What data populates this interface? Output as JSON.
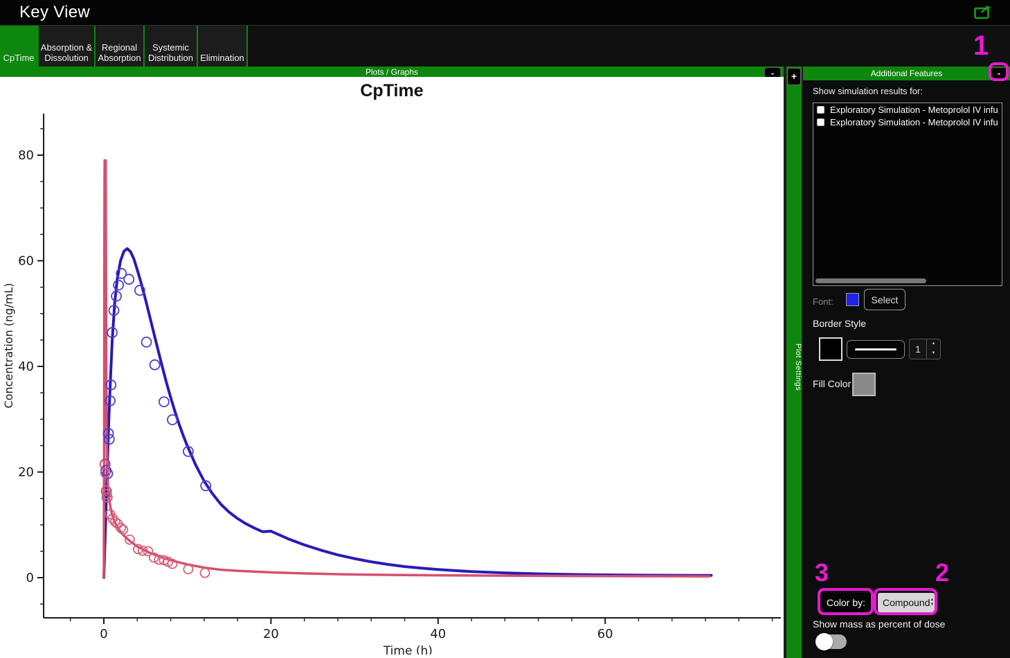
{
  "window": {
    "title": "Key View"
  },
  "tabs": [
    {
      "label": "CpTime",
      "active": true
    },
    {
      "label": "Absorption &\nDissolution",
      "active": false
    },
    {
      "label": "Regional\nAbsorption",
      "active": false
    },
    {
      "label": "Systemic\nDistribution",
      "active": false
    },
    {
      "label": "Elimination",
      "active": false
    }
  ],
  "plots_panel": {
    "header": "Plots / Graphs",
    "collapse_label": "-",
    "expand_label": "+",
    "strip_label": "Plot Settings"
  },
  "sidebar": {
    "header": "Additional Features",
    "collapse_label": "-",
    "results_label": "Show simulation results for:",
    "results": [
      {
        "label": "Exploratory Simulation - Metoprolol IV infu",
        "checked": false
      },
      {
        "label": "Exploratory Simulation - Metoprolol IV infu",
        "checked": false
      }
    ],
    "font_label": "Font:",
    "select_label": "Select",
    "border_style_label": "Border Style",
    "border_width_value": "1",
    "fill_color_label": "Fill Color",
    "color_by_label": "Color by:",
    "color_by_value": "Compound",
    "show_mass_label": "Show mass as percent of dose",
    "show_mass_on": false
  },
  "annotations": [
    {
      "number": "1"
    },
    {
      "number": "2"
    },
    {
      "number": "3"
    }
  ],
  "colors": {
    "accent_green": "#0d870d",
    "annotation_magenta": "#e61ad0",
    "font_swatch_blue": "#2222ee",
    "fill_swatch_gray": "#8a8a8a",
    "border_swatch_black": "#000000"
  },
  "chart_data": {
    "type": "line",
    "title": "CpTime",
    "xlabel": "Time (h)",
    "ylabel": "Concentration (ng/mL)",
    "xlim": [
      -7.2,
      81
    ],
    "ylim": [
      -7.7,
      87.5
    ],
    "x_major_ticks": [
      0,
      20,
      40,
      60
    ],
    "x_minor_step": 4,
    "y_major_ticks": [
      0,
      20,
      40,
      60,
      80
    ],
    "y_minor_step": 5,
    "grid": false,
    "legend": "none",
    "series": [
      {
        "name": "simulated-line-blue",
        "type": "line",
        "color": "#2a1ab9",
        "width": 4,
        "points": [
          [
            0,
            0
          ],
          [
            0.2,
            10
          ],
          [
            0.4,
            20
          ],
          [
            0.6,
            30
          ],
          [
            0.8,
            38
          ],
          [
            1.0,
            45
          ],
          [
            1.3,
            52
          ],
          [
            1.6,
            56.5
          ],
          [
            2.0,
            60
          ],
          [
            2.4,
            61.8
          ],
          [
            2.8,
            62.3
          ],
          [
            3.2,
            61.7
          ],
          [
            3.6,
            60.3
          ],
          [
            4.0,
            58.3
          ],
          [
            4.5,
            55.6
          ],
          [
            5,
            52.6
          ],
          [
            5.5,
            49.4
          ],
          [
            6,
            46.2
          ],
          [
            6.5,
            43
          ],
          [
            7,
            39.9
          ],
          [
            7.5,
            36.9
          ],
          [
            8,
            34.1
          ],
          [
            8.5,
            31.5
          ],
          [
            9,
            29.1
          ],
          [
            9.5,
            26.9
          ],
          [
            10,
            24.9
          ],
          [
            11,
            21.3
          ],
          [
            12,
            18.3
          ],
          [
            13,
            15.9
          ],
          [
            14,
            13.9
          ],
          [
            15,
            12.4
          ],
          [
            16,
            11.2
          ],
          [
            17,
            10.2
          ],
          [
            18,
            9.4
          ],
          [
            19,
            8.7
          ],
          [
            20,
            8.8
          ],
          [
            22,
            7.4
          ],
          [
            24,
            6.2
          ],
          [
            26,
            5.2
          ],
          [
            28,
            4.3
          ],
          [
            30,
            3.6
          ],
          [
            32,
            3.0
          ],
          [
            34,
            2.5
          ],
          [
            36,
            2.1
          ],
          [
            38,
            1.8
          ],
          [
            40,
            1.55
          ],
          [
            44,
            1.15
          ],
          [
            48,
            0.9
          ],
          [
            52,
            0.72
          ],
          [
            56,
            0.6
          ],
          [
            60,
            0.52
          ],
          [
            64,
            0.47
          ],
          [
            68,
            0.44
          ],
          [
            72.7,
            0.42
          ]
        ]
      },
      {
        "name": "simulated-line-red",
        "type": "line",
        "color": "#d5506e",
        "width": 3.5,
        "points": [
          [
            0,
            0
          ],
          [
            0.04,
            30
          ],
          [
            0.06,
            60
          ],
          [
            0.08,
            76
          ],
          [
            0.1,
            79
          ],
          [
            0.22,
            79
          ],
          [
            0.26,
            60
          ],
          [
            0.3,
            38
          ],
          [
            0.34,
            27
          ],
          [
            0.4,
            21.5
          ],
          [
            0.5,
            17.5
          ],
          [
            0.65,
            14.8
          ],
          [
            0.8,
            13.2
          ],
          [
            1,
            11.8
          ],
          [
            1.25,
            10.7
          ],
          [
            1.5,
            9.9
          ],
          [
            2,
            8.7
          ],
          [
            2.5,
            7.8
          ],
          [
            3,
            7.1
          ],
          [
            3.5,
            6.5
          ],
          [
            4,
            5.9
          ],
          [
            4.5,
            5.5
          ],
          [
            5,
            5.1
          ],
          [
            5.5,
            4.7
          ],
          [
            6,
            4.4
          ],
          [
            7,
            3.8
          ],
          [
            8,
            3.3
          ],
          [
            9,
            2.9
          ],
          [
            10,
            2.5
          ],
          [
            11,
            2.2
          ],
          [
            12,
            1.9
          ],
          [
            14,
            1.5
          ],
          [
            16,
            1.3
          ],
          [
            18,
            1.15
          ],
          [
            20,
            1.0
          ],
          [
            24,
            0.8
          ],
          [
            28,
            0.65
          ],
          [
            32,
            0.55
          ],
          [
            36,
            0.5
          ],
          [
            40,
            0.45
          ],
          [
            48,
            0.38
          ],
          [
            56,
            0.32
          ],
          [
            64,
            0.28
          ],
          [
            72.5,
            0.25
          ]
        ]
      },
      {
        "name": "observed-scatter-blue",
        "type": "scatter",
        "color": "#4a3fd0",
        "radius": 7,
        "points": [
          [
            0.15,
            21.5
          ],
          [
            0.25,
            20.3
          ],
          [
            0.3,
            16.4
          ],
          [
            0.4,
            15.2
          ],
          [
            0.45,
            19.7
          ],
          [
            0.55,
            27.3
          ],
          [
            0.65,
            26.2
          ],
          [
            0.75,
            33.5
          ],
          [
            0.85,
            36.5
          ],
          [
            1.0,
            46.4
          ],
          [
            1.2,
            50.6
          ],
          [
            1.5,
            53.3
          ],
          [
            1.75,
            55.4
          ],
          [
            2.1,
            57.6
          ],
          [
            3.0,
            56.5
          ],
          [
            4.3,
            54.4
          ],
          [
            5.1,
            44.6
          ],
          [
            6.1,
            40.3
          ],
          [
            7.2,
            33.3
          ],
          [
            8.2,
            29.9
          ],
          [
            10.1,
            23.9
          ],
          [
            12.2,
            17.4
          ]
        ]
      },
      {
        "name": "observed-scatter-red",
        "type": "scatter",
        "color": "#d5607a",
        "radius": 6.5,
        "points": [
          [
            0.1,
            21.4
          ],
          [
            0.18,
            19.8
          ],
          [
            0.28,
            16.5
          ],
          [
            0.35,
            15.8
          ],
          [
            0.42,
            15.2
          ],
          [
            0.75,
            12.0
          ],
          [
            1.05,
            11.2
          ],
          [
            1.35,
            10.6
          ],
          [
            1.65,
            10.2
          ],
          [
            2.05,
            9.4
          ],
          [
            2.3,
            9.1
          ],
          [
            3.1,
            7.2
          ],
          [
            4.1,
            5.4
          ],
          [
            4.65,
            5.1
          ],
          [
            5.3,
            5.0
          ],
          [
            6.0,
            3.8
          ],
          [
            6.6,
            3.4
          ],
          [
            7.2,
            3.3
          ],
          [
            7.7,
            3.0
          ],
          [
            8.2,
            2.6
          ],
          [
            10.1,
            1.6
          ],
          [
            12.1,
            0.9
          ]
        ]
      }
    ]
  }
}
